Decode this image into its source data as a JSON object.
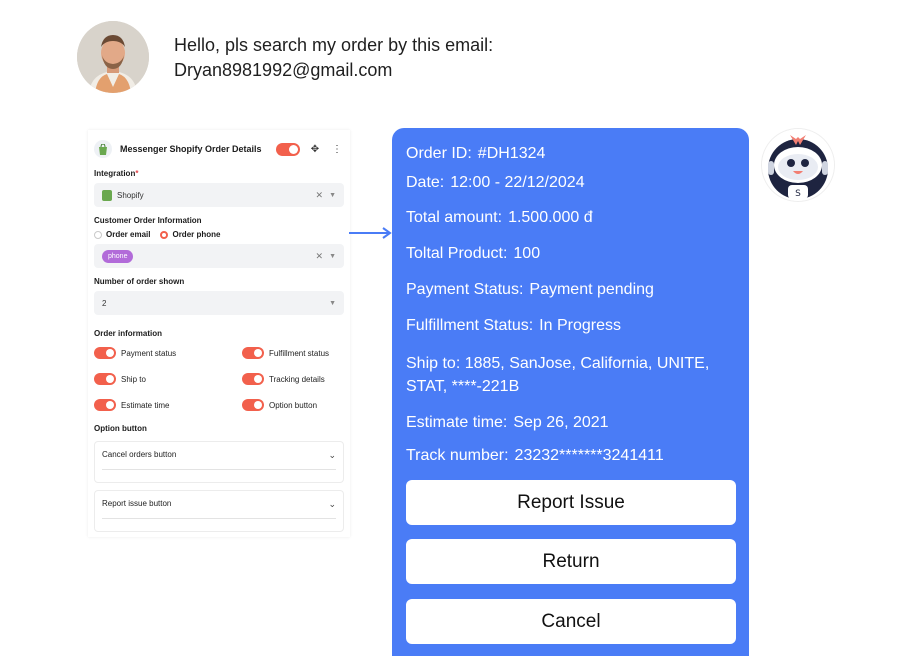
{
  "user_message": {
    "line1": "Hello, pls search my order by this email:",
    "line2": "Dryan8981992@gmail.com"
  },
  "settings_panel": {
    "title": "Messenger Shopify Order Details",
    "integration_label": "Integration",
    "integration_required": "*",
    "integration_value": "Shopify",
    "customer_info_label": "Customer Order Information",
    "radio_options": [
      "Order email",
      "Order phone"
    ],
    "selected_radio": "Order phone",
    "phone_chip": "phone",
    "orders_shown_label": "Number of order shown",
    "orders_shown_value": "2",
    "order_info_label": "Order information",
    "toggles": [
      "Payment status",
      "Fulfillment status",
      "Ship to",
      "Tracking details",
      "Estimate time",
      "Option button"
    ],
    "option_button_label": "Option button",
    "accordions": [
      "Cancel orders button",
      "Report issue button"
    ]
  },
  "order_card": {
    "order_id_key": "Order ID:",
    "order_id": "#DH1324",
    "date_key": "Date:",
    "date": "12:00 - 22/12/2024",
    "total_key": "Total amount:",
    "total": "1.500.000 đ",
    "product_key": "Toltal Product:",
    "product": "100",
    "payment_key": "Payment Status:",
    "payment": "Payment pending",
    "fulfillment_key": "Fulfillment Status:",
    "fulfillment": "In Progress",
    "ship_to": "Ship to: 1885, SanJose, California, UNITE, STAT, ****-221B",
    "estimate_key": "Estimate time:",
    "estimate": "Sep 26, 2021",
    "track_key": "Track number:",
    "track": "23232*******3241411",
    "buttons": [
      "Report Issue",
      "Return",
      "Cancel"
    ]
  },
  "colors": {
    "card_blue": "#4a7cf6",
    "toggle_orange": "#f2604c",
    "chip_purple": "#b26bd9"
  },
  "icons": [
    "user-avatar",
    "shopify-bag-icon",
    "move-icon",
    "more-vertical-icon",
    "close-icon",
    "chevron-down-icon",
    "arrow-right-icon",
    "bot-avatar"
  ]
}
